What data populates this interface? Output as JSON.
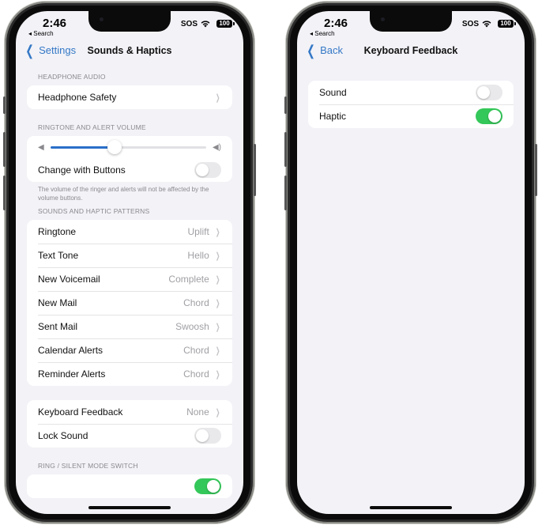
{
  "left_phone": {
    "status": {
      "time": "2:46",
      "back_app": "◂ Search",
      "sos": "SOS",
      "battery": "100"
    },
    "nav": {
      "back_label": "Settings",
      "title": "Sounds & Haptics"
    },
    "sections": {
      "headphone_audio": {
        "header": "HEADPHONE AUDIO",
        "headphone_safety": "Headphone Safety"
      },
      "ringtone_volume": {
        "header": "RINGTONE AND ALERT VOLUME",
        "volume_percent": 41,
        "change_with_buttons": "Change with Buttons",
        "change_with_buttons_on": false,
        "footer": "The volume of the ringer and alerts will not be affected by the volume buttons."
      },
      "patterns": {
        "header": "SOUNDS AND HAPTIC PATTERNS",
        "items": [
          {
            "label": "Ringtone",
            "value": "Uplift"
          },
          {
            "label": "Text Tone",
            "value": "Hello"
          },
          {
            "label": "New Voicemail",
            "value": "Complete"
          },
          {
            "label": "New Mail",
            "value": "Chord"
          },
          {
            "label": "Sent Mail",
            "value": "Swoosh"
          },
          {
            "label": "Calendar Alerts",
            "value": "Chord"
          },
          {
            "label": "Reminder Alerts",
            "value": "Chord"
          }
        ]
      },
      "system": {
        "keyboard_feedback": "Keyboard Feedback",
        "keyboard_feedback_value": "None",
        "lock_sound": "Lock Sound",
        "lock_sound_on": false
      },
      "ring_silent": {
        "header": "RING / SILENT MODE SWITCH",
        "toggle_on": true
      }
    }
  },
  "right_phone": {
    "status": {
      "time": "2:46",
      "back_app": "◂ Search",
      "sos": "SOS",
      "battery": "100"
    },
    "nav": {
      "back_label": "Back",
      "title": "Keyboard Feedback"
    },
    "items": [
      {
        "label": "Sound",
        "on": false
      },
      {
        "label": "Haptic",
        "on": true
      }
    ]
  },
  "colors": {
    "accent": "#3478c6",
    "toggle_on": "#34c759",
    "background": "#f2f2f7"
  }
}
